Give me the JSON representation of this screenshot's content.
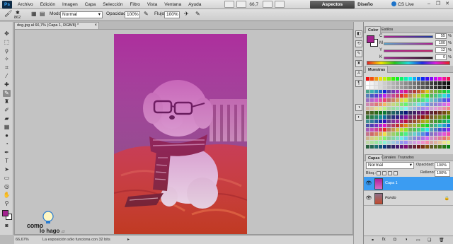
{
  "app": {
    "logo_text": "Ps",
    "zoom_display": "66,7",
    "workspace_active": "Aspectos esenciales",
    "workspace_other": "Diseño",
    "cslive": "CS Live",
    "window_controls": [
      "–",
      "❐",
      "✕"
    ]
  },
  "menu": [
    "Archivo",
    "Edición",
    "Imagen",
    "Capa",
    "Selección",
    "Filtro",
    "Vista",
    "Ventana",
    "Ayuda"
  ],
  "options": {
    "brush_size": "862",
    "mode_label": "Modo:",
    "mode_value": "Normal",
    "opacity_label": "Opacidad:",
    "opacity_value": "100%",
    "flow_label": "Flujo:",
    "flow_value": "100%"
  },
  "document": {
    "tab_title": "dog.jpg al 66,7% (Capa 1, RGB/8) *",
    "close": "×"
  },
  "status": {
    "zoom": "66,67%",
    "message": "La exposición sólo funciona con 32 bits"
  },
  "watermark": {
    "line1": "como",
    "line2": "lo hago",
    "suffix": ".cl"
  },
  "color_panel": {
    "tabs": [
      "Color",
      "Estilos"
    ],
    "channels": [
      {
        "label": "C",
        "value": "55"
      },
      {
        "label": "M",
        "value": "100"
      },
      {
        "label": "Y",
        "value": "12"
      },
      {
        "label": "K",
        "value": "0"
      }
    ],
    "percent": "%",
    "foreground": "#a3238f"
  },
  "swatches_panel": {
    "title": "Muestras"
  },
  "layers_panel": {
    "tabs": [
      "Capas",
      "Canales",
      "Trazados"
    ],
    "blend_mode": "Normal",
    "opacity_label": "Opacidad:",
    "opacity_value": "100%",
    "lock_label": "Bloq.:",
    "fill_label": "Relleno:",
    "fill_value": "100%",
    "layers": [
      {
        "name": "Capa 1",
        "selected": true
      },
      {
        "name": "Fondo",
        "selected": false
      }
    ]
  },
  "colors": {
    "selection_blue": "#3b9cf2",
    "overlay_magenta": "#b01e9b"
  }
}
